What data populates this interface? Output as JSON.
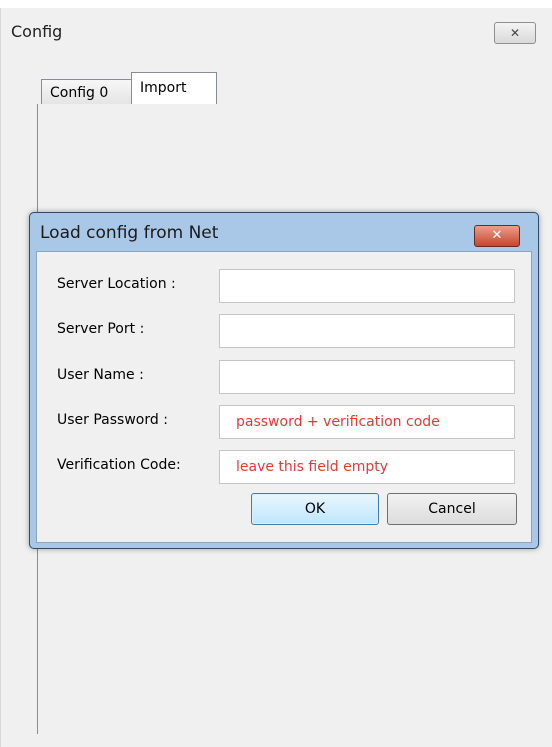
{
  "window": {
    "title": "Config",
    "close_glyph": "✕"
  },
  "tabs": [
    {
      "label": "Config 0",
      "selected": false
    },
    {
      "label": "Import",
      "selected": true
    }
  ],
  "dialog": {
    "title": "Load config from Net",
    "close_glyph": "✕",
    "fields": [
      {
        "label": "Server Location :",
        "value": ""
      },
      {
        "label": "Server Port :",
        "value": ""
      },
      {
        "label": "User Name :",
        "value": ""
      },
      {
        "label": "User Password :",
        "value": "password + verification code"
      },
      {
        "label": "Verification Code:",
        "value": "leave this field empty"
      }
    ],
    "ok_label": "OK",
    "cancel_label": "Cancel"
  },
  "colors": {
    "annotation_text": "#e53935",
    "dialog_frame": "#a9c8e8",
    "close_button": "#c7452c"
  }
}
